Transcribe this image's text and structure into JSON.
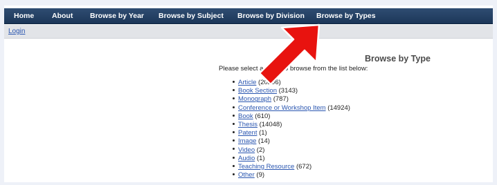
{
  "nav": {
    "items": [
      "Home",
      "About",
      "Browse by Year",
      "Browse by Subject",
      "Browse by Division",
      "Browse by Types"
    ]
  },
  "subbar": {
    "login": "Login"
  },
  "main": {
    "title": "Browse by Type",
    "intro": "Please select a value to browse from the list below:"
  },
  "types": [
    {
      "label": "Article",
      "count": "(20206)"
    },
    {
      "label": "Book Section",
      "count": "(3143)"
    },
    {
      "label": "Monograph",
      "count": "(787)"
    },
    {
      "label": "Conference or Workshop Item",
      "count": "(14924)"
    },
    {
      "label": "Book",
      "count": "(610)"
    },
    {
      "label": "Thesis",
      "count": "(14048)"
    },
    {
      "label": "Patent",
      "count": "(1)"
    },
    {
      "label": "Image",
      "count": "(14)"
    },
    {
      "label": "Video",
      "count": "(2)"
    },
    {
      "label": "Audio",
      "count": "(1)"
    },
    {
      "label": "Teaching Resource",
      "count": "(672)"
    },
    {
      "label": "Other",
      "count": "(9)"
    }
  ],
  "colors": {
    "nav_bg": "#1c3658",
    "link": "#2a56b0",
    "arrow": "#e8130f"
  },
  "annotation_icon": "red-arrow-icon"
}
